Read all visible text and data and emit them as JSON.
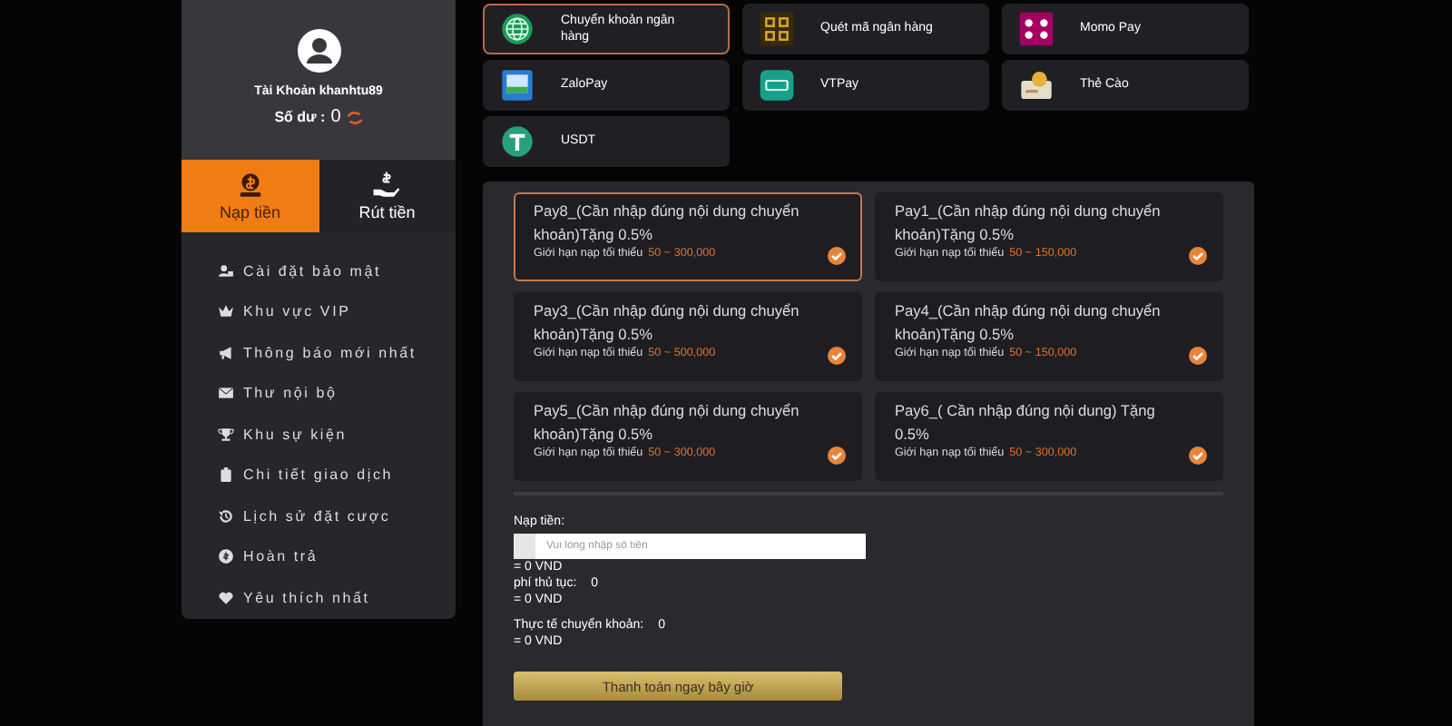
{
  "account": {
    "name": "Tài Khoản khanhtu89",
    "balance_label": "Số dư :",
    "balance": "0"
  },
  "tabs": [
    {
      "label": "Nạp tiền",
      "selected": true,
      "kind": "deposit"
    },
    {
      "label": "Rút tiền",
      "selected": false,
      "kind": "withdraw"
    }
  ],
  "menu": [
    {
      "label": "Cài đặt bảo mật",
      "kind": "security"
    },
    {
      "label": "Khu vực VIP",
      "kind": "vip"
    },
    {
      "label": "Thông báo mới nhất",
      "kind": "news"
    },
    {
      "label": "Thư nội bộ",
      "kind": "mail"
    },
    {
      "label": "Khu sự kiện",
      "kind": "trophy"
    },
    {
      "label": "Chi tiết giao dịch",
      "kind": "wallet"
    },
    {
      "label": "Lịch sử đặt cược",
      "kind": "history"
    },
    {
      "label": "Hoàn trả",
      "kind": "refund"
    },
    {
      "label": "Yêu thích nhất",
      "kind": "heart"
    }
  ],
  "payment_methods": [
    {
      "label": "Chuyển khoản ngân hàng",
      "kind": "bank",
      "selected": true
    },
    {
      "label": "Quét mã ngân hàng",
      "kind": "qr",
      "selected": false
    },
    {
      "label": "Momo Pay",
      "kind": "momo",
      "selected": false
    },
    {
      "label": "ZaloPay",
      "kind": "zalo",
      "selected": false
    },
    {
      "label": "VTPay",
      "kind": "vtpay",
      "selected": false
    },
    {
      "label": "Thẻ Cào",
      "kind": "card",
      "selected": false
    },
    {
      "label": "USDT",
      "kind": "usdt",
      "selected": false
    }
  ],
  "channels": [
    {
      "title": "Pay8_(Cần nhập đúng nội dung chuyển khoản)Tặng 0.5%",
      "limit_label": "Giới hạn nạp tối thiểu",
      "limit_range": "50 ~ 300,000",
      "selected": true
    },
    {
      "title": "Pay1_(Cần nhập đúng nội dung chuyển khoản)Tặng 0.5%",
      "limit_label": "Giới hạn nạp tối thiểu",
      "limit_range": "50 ~ 150,000",
      "selected": false
    },
    {
      "title": "Pay3_(Cần nhập đúng nội dung chuyển khoản)Tặng 0.5%",
      "limit_label": "Giới hạn nạp tối thiểu",
      "limit_range": "50 ~ 500,000",
      "selected": false
    },
    {
      "title": "Pay4_(Cần nhập đúng nội dung chuyển khoản)Tặng 0.5%",
      "limit_label": "Giới hạn nạp tối thiểu",
      "limit_range": "50 ~ 150,000",
      "selected": false
    },
    {
      "title": "Pay5_(Cần nhập đúng nội dung chuyển khoản)Tặng 0.5%",
      "limit_label": "Giới hạn nạp tối thiểu",
      "limit_range": "50 ~ 300,000",
      "selected": false
    },
    {
      "title": "Pay6_( Cần nhập đúng nội dung) Tặng 0.5%",
      "limit_label": "Giới hạn nạp tối thiểu",
      "limit_range": "50 ~ 300,000",
      "selected": false
    }
  ],
  "form": {
    "amount_label": "Nạp tiền:",
    "amount_placeholder": "Vui lòng nhập số tiền",
    "amount_converted": "= 0 VND",
    "fee_label": "phí thủ tục:",
    "fee": "0",
    "fee_converted": "= 0 VND",
    "actual_label": "Thực tế chuyển khoản:",
    "actual": "0",
    "actual_converted": "= 0 VND",
    "submit": "Thanh toán ngay bây giờ"
  }
}
